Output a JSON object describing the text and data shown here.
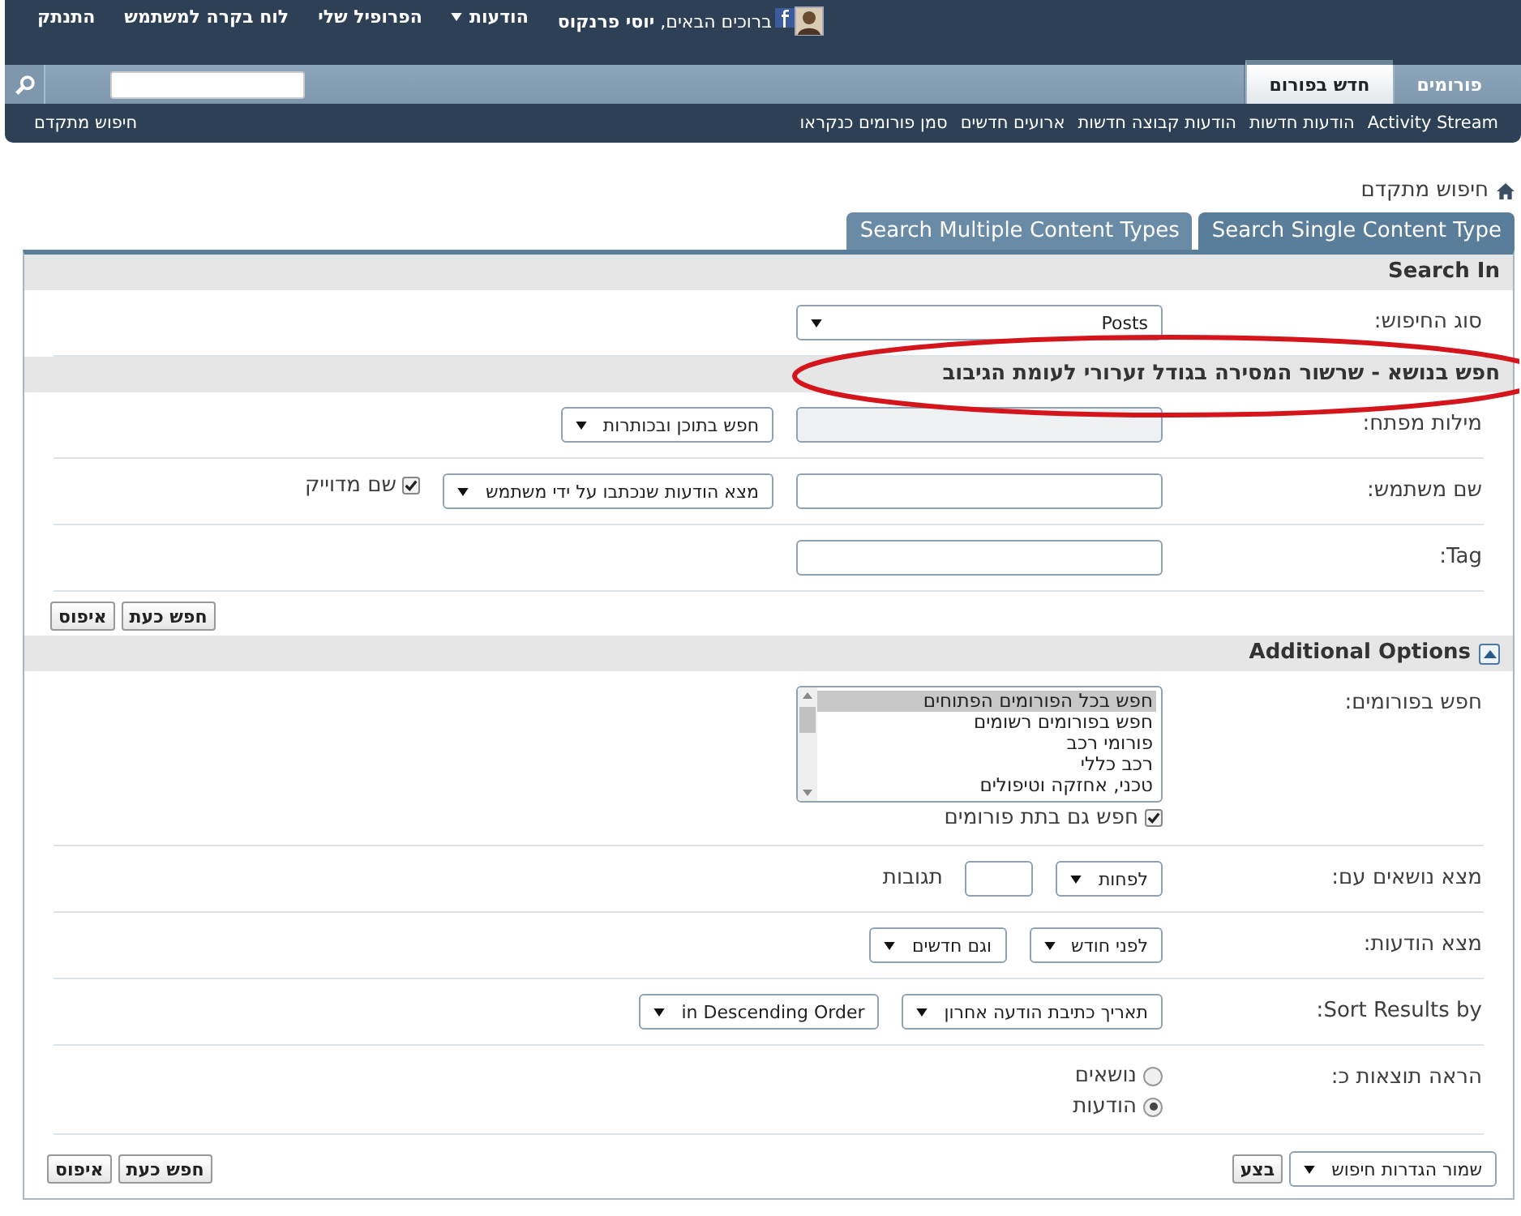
{
  "top_bar": {
    "welcome": "ברוכים הבאים, **יוסי פרנקוס**",
    "links": [
      {
        "label": "הודעות",
        "has_menu": true
      },
      {
        "label": "הפרופיל שלי",
        "has_menu": false
      },
      {
        "label": "לוח בקרה למשתמש",
        "has_menu": false
      },
      {
        "label": "התנתק",
        "has_menu": false
      }
    ]
  },
  "nav": {
    "tabs": [
      {
        "label": "פורומים",
        "selected": false
      },
      {
        "label": "חדש בפורום",
        "selected": true
      }
    ]
  },
  "sub_nav": {
    "links": [
      "Activity Stream",
      "הודעות חדשות",
      "הודעות קבוצה חדשות",
      "ארועים חדשים",
      "סמן פורומים כנקראו"
    ],
    "advanced_search": "חיפוש מתקדם"
  },
  "breadcrumb": "חיפוש מתקדם",
  "search_tabs": [
    {
      "label": "Search Single Content Type",
      "selected": true
    },
    {
      "label": "Search Multiple Content Types",
      "selected": false
    }
  ],
  "search_in": {
    "heading": "Search In",
    "type_label": "סוג החיפוש:",
    "type_value": "Posts"
  },
  "annotation": {
    "kind": "ellipse"
  },
  "thread_heading": "חפש בנושא - שרשור המסירה בגודל זערורי לעומת הגיבוב",
  "rows": [
    {
      "label": "מילות מפתח:",
      "controls": [
        {
          "kind": "input",
          "disabled": true
        },
        {
          "kind": "select",
          "value": "חפש בתוכן ובכותרות"
        }
      ]
    },
    {
      "label": "שם משתמש:",
      "controls": [
        {
          "kind": "input",
          "disabled": false
        },
        {
          "kind": "select",
          "value": "מצא הודעות שנכתבו על ידי משתמש"
        },
        {
          "kind": "checkbox",
          "label": "שם מדוייק",
          "checked": true
        }
      ]
    },
    {
      "label": "Tag:",
      "controls": [
        {
          "kind": "input",
          "disabled": false
        }
      ]
    }
  ],
  "buttons": [
    "חפש כעת",
    "איפוס"
  ],
  "additional": {
    "heading": "Additional Options",
    "expanded": true,
    "rows": [
      {
        "label": "חפש בפורומים:",
        "controls": [
          {
            "kind": "listbox",
            "items": [
              {
                "label": "חפש בכל הפורומים הפתוחים",
                "selected": true
              },
              {
                "label": "חפש בפורומים רשומים",
                "selected": false
              },
              {
                "label": "פורומי רכב",
                "selected": false
              },
              {
                "label": "רכב כללי",
                "selected": false
              },
              {
                "label": "טכני, אחזקה וטיפולים",
                "selected": false
              }
            ],
            "checkbox": {
              "label": "חפש גם בתת פורומים",
              "checked": true
            }
          }
        ]
      },
      {
        "label": "מצא נושאים עם:",
        "controls": [
          {
            "kind": "select",
            "value": "לפחות"
          },
          {
            "kind": "input",
            "disabled": false
          },
          {
            "kind": "text",
            "value": "תגובות"
          }
        ]
      },
      {
        "label": "מצא הודעות:",
        "controls": [
          {
            "kind": "select",
            "value": "לפני חודש"
          },
          {
            "kind": "select",
            "value": "וגם חדשים"
          }
        ]
      },
      {
        "label": "Sort Results by:",
        "controls": [
          {
            "kind": "select",
            "value": "תאריך כתיבת הודעה אחרון"
          },
          {
            "kind": "select",
            "value": "in Descending Order"
          }
        ]
      },
      {
        "label": "הראה תוצאות כ:",
        "controls": [
          {
            "kind": "radios",
            "options": [
              {
                "label": "נושאים",
                "selected": false
              },
              {
                "label": "הודעות",
                "selected": true
              }
            ]
          }
        ]
      }
    ]
  },
  "footer": {
    "save_select": "שמור הגדרות חיפוש",
    "go_button": "בצע",
    "buttons": [
      "חפש כעת",
      "איפוס"
    ]
  }
}
